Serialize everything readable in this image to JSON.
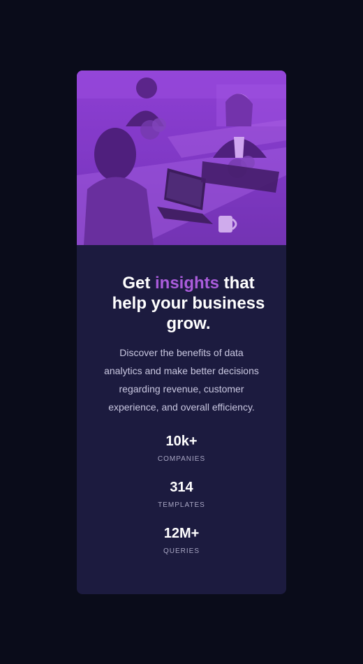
{
  "card": {
    "image_alt": "three people working at desks with laptops",
    "heading": {
      "before": "Get ",
      "accent": "insights",
      "after": " that help your business grow."
    },
    "description": "Discover the benefits of data analytics and make better decisions regarding revenue, customer experience, and overall efficiency.",
    "stats": [
      {
        "value": "10k+",
        "label": "COMPANIES"
      },
      {
        "value": "314",
        "label": "TEMPLATES"
      },
      {
        "value": "12M+",
        "label": "QUERIES"
      }
    ]
  },
  "colors": {
    "page_background": "#0a0c1a",
    "card_background": "#1c1b3f",
    "accent": "#aa5cdb",
    "image_overlay": "#8e3fd4"
  }
}
